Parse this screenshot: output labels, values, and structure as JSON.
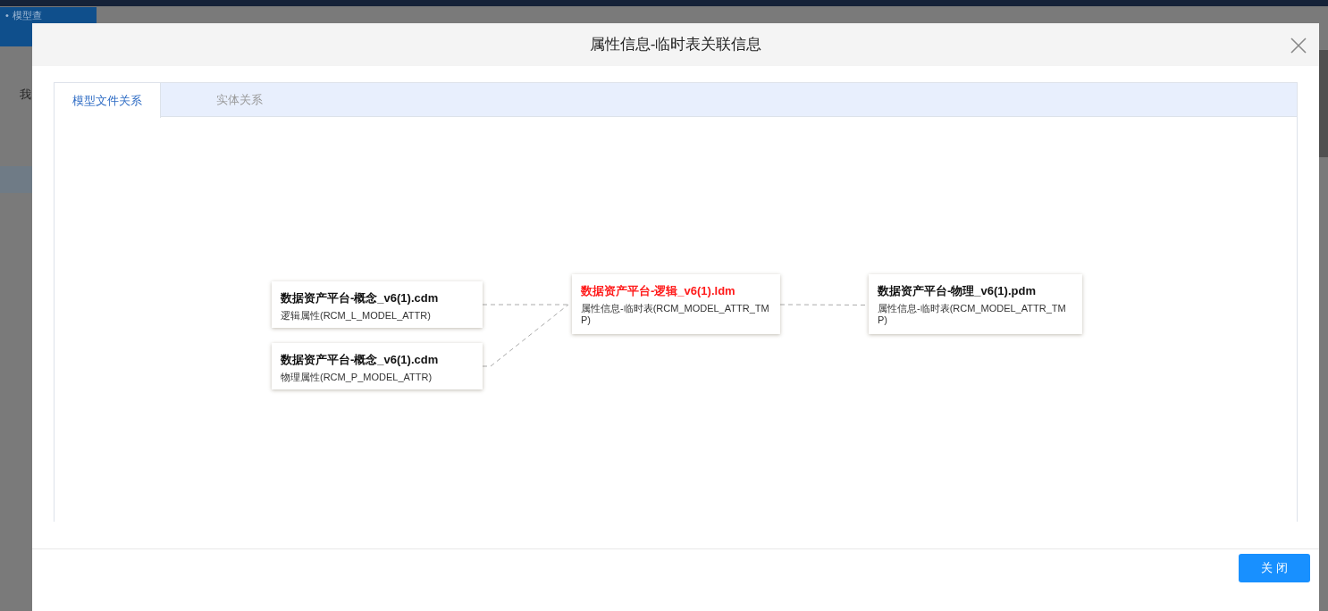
{
  "background": {
    "tab": {
      "bullet": "•",
      "label": "模型查"
    },
    "tree_label": "我"
  },
  "dialog": {
    "title": "属性信息-临时表关联信息",
    "tabs": [
      {
        "label": "模型文件关系",
        "selected": true
      },
      {
        "label": "实体关系",
        "selected": false
      }
    ],
    "diagram": {
      "nodes": [
        {
          "title": "数据资产平台-概念_v6(1).cdm",
          "subtitle": "逻辑属性(RCM_L_MODEL_ATTR)",
          "highlighted": false
        },
        {
          "title": "数据资产平台-概念_v6(1).cdm",
          "subtitle": "物理属性(RCM_P_MODEL_ATTR)",
          "highlighted": false
        },
        {
          "title": "数据资产平台-逻辑_v6(1).ldm",
          "subtitle": "属性信息-临时表(RCM_MODEL_ATTR_TMP)",
          "highlighted": true
        },
        {
          "title": "数据资产平台-物理_v6(1).pdm",
          "subtitle": "属性信息-临时表(RCM_MODEL_ATTR_TMP)",
          "highlighted": false
        }
      ]
    },
    "buttons": [
      {
        "label": "关 闭"
      }
    ]
  }
}
